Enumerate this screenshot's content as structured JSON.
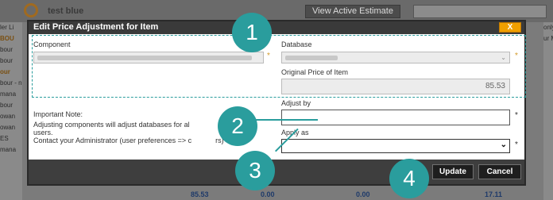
{
  "background": {
    "user_name": "test blue",
    "estimate_button_label": "View Active Estimate",
    "left_fragments": [
      "ler Li",
      "",
      "BOU",
      "bour",
      "bour",
      "our",
      "bour - n",
      "mana",
      "bour",
      "owan",
      "owan",
      "ES",
      "mana"
    ],
    "right_fragments": [
      "",
      "",
      "only",
      "ur M",
      "",
      "",
      "",
      "",
      "",
      "",
      "",
      "",
      ""
    ],
    "bottom_values": [
      "85.53",
      "0.00",
      "0.00",
      "17.11"
    ]
  },
  "modal": {
    "title": "Edit Price Adjustment for Item",
    "close_label": "X",
    "component": {
      "label": "Component",
      "required_marker": "*"
    },
    "database": {
      "label": "Database",
      "required_marker": "*"
    },
    "original_price": {
      "label": "Original Price of Item",
      "value": "85.53"
    },
    "note": {
      "heading": "Important Note:",
      "line1": "Adjusting components will adjust databases for al",
      "line2": "users.",
      "line3": "Contact your Administrator (user preferences => c",
      "line3_tail": "rs)"
    },
    "adjust_by": {
      "label": "Adjust by",
      "value": "",
      "required_marker": "*"
    },
    "apply_as": {
      "label": "Apply as",
      "value": "",
      "required_marker": "*"
    },
    "buttons": {
      "update": "Update",
      "cancel": "Cancel"
    }
  },
  "callouts": [
    "1",
    "2",
    "3",
    "4"
  ],
  "colors": {
    "callout": "#2a9d9d",
    "required_star": "#d39a2a",
    "title_bar": "#3a3a3a",
    "close_button": "#f0a000"
  }
}
